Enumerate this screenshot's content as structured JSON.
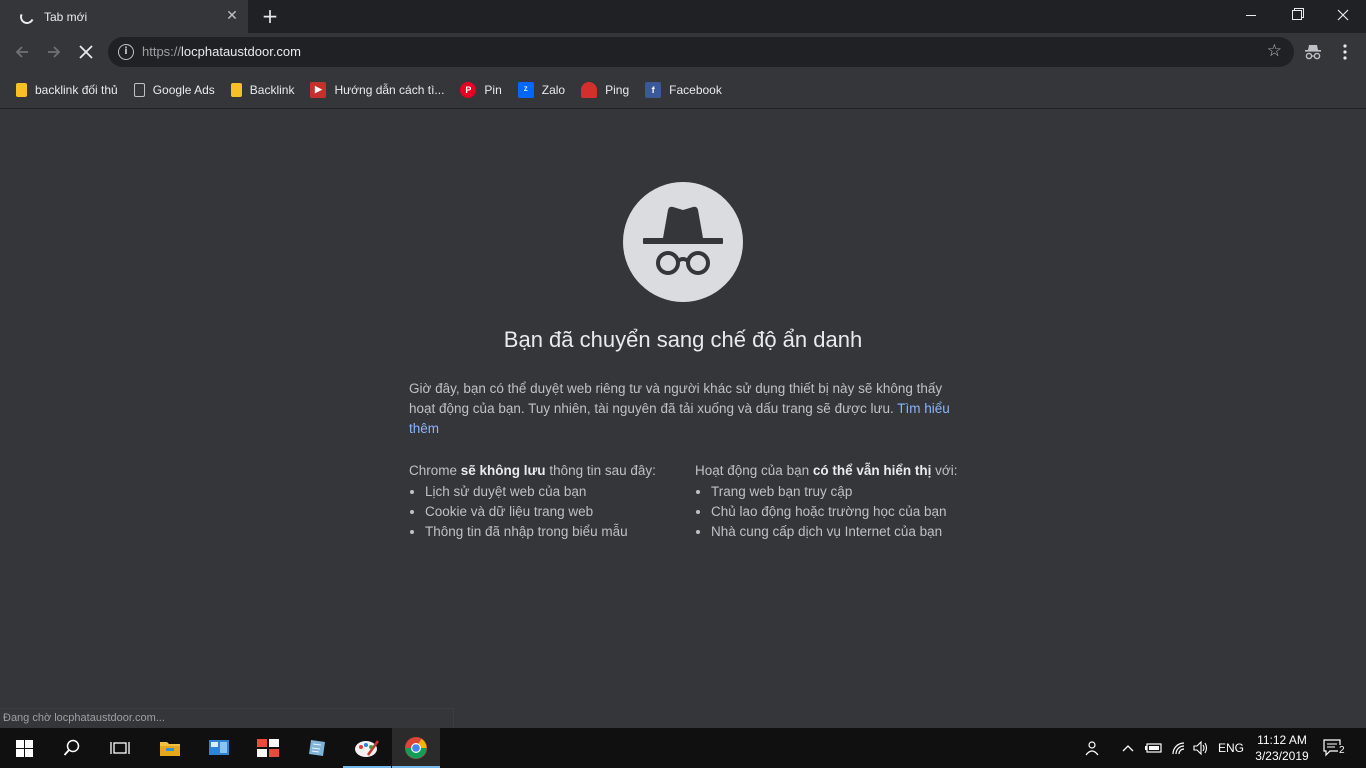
{
  "tab": {
    "title": "Tab mới",
    "close": "✕"
  },
  "toolbar": {
    "url_scheme": "https://",
    "url_host": "locphataustdoor.com"
  },
  "bookmarks": [
    {
      "label": "backlink đối thủ",
      "icon": "folder-icon"
    },
    {
      "label": "Google Ads",
      "icon": "page-icon"
    },
    {
      "label": "Backlink",
      "icon": "folder-icon"
    },
    {
      "label": "Hướng dẫn cách tì...",
      "icon": "youtube-icon"
    },
    {
      "label": "Pin",
      "icon": "pinterest-icon"
    },
    {
      "label": "Zalo",
      "icon": "zalo-icon"
    },
    {
      "label": "Ping",
      "icon": "ping-icon"
    },
    {
      "label": "Facebook",
      "icon": "facebook-icon"
    }
  ],
  "incognito": {
    "headline": "Bạn đã chuyển sang chế độ ẩn danh",
    "intro": "Giờ đây, bạn có thể duyệt web riêng tư và người khác sử dụng thiết bị này sẽ không thấy hoạt động của bạn. Tuy nhiên, tài nguyên đã tải xuống và dấu trang sẽ được lưu. ",
    "learn_more": "Tìm hiểu thêm",
    "left_head_pre": "Chrome ",
    "left_head_bold": "sẽ không lưu",
    "left_head_post": " thông tin sau đây:",
    "left_items": [
      "Lịch sử duyệt web của bạn",
      "Cookie và dữ liệu trang web",
      "Thông tin đã nhập trong biểu mẫu"
    ],
    "right_head_pre": "Hoạt động của bạn ",
    "right_head_bold": "có thể vẫn hiển thị",
    "right_head_post": " với:",
    "right_items": [
      "Trang web bạn truy cập",
      "Chủ lao động hoặc trường học của bạn",
      "Nhà cung cấp dịch vụ Internet của bạn"
    ]
  },
  "status_text": "Đang chờ locphataustdoor.com...",
  "taskbar": {
    "language": "ENG",
    "time": "11:12 AM",
    "date": "3/23/2019",
    "notification_count": "2"
  }
}
